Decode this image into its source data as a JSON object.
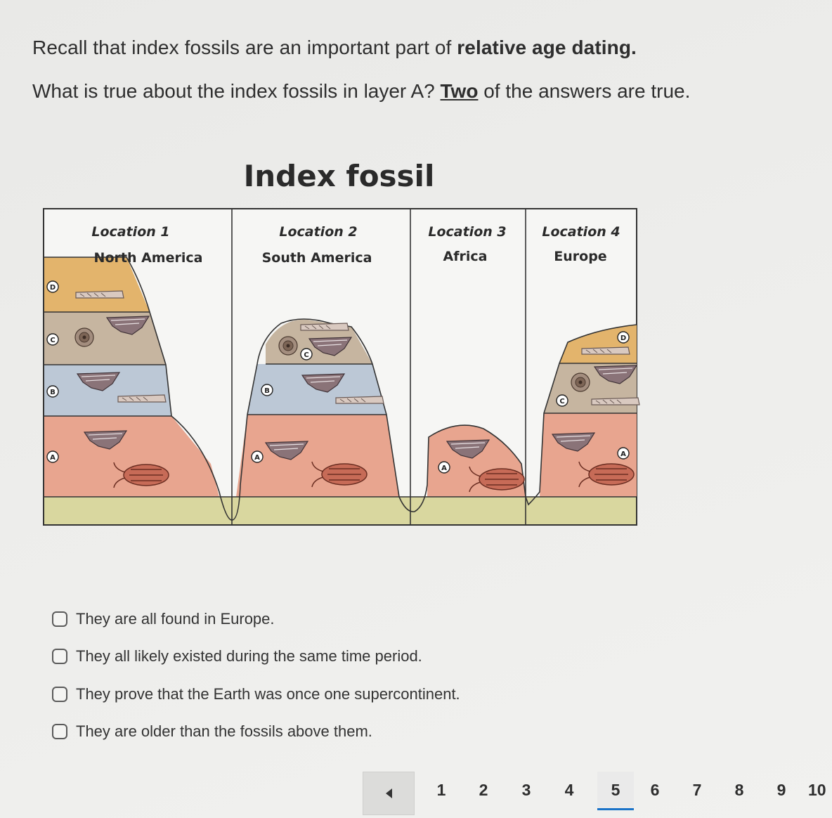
{
  "question": {
    "line1_prefix": "Recall that index fossils are an important part of ",
    "line1_bold": "relative age dating.",
    "line2_prefix": "What is true about the index fossils in layer A? ",
    "line2_emph": "Two",
    "line2_suffix": " of the answers are true."
  },
  "figure": {
    "title": "Index fossil",
    "locations": [
      {
        "label": "Location 1",
        "region": "North America"
      },
      {
        "label": "Location 2",
        "region": "South America"
      },
      {
        "label": "Location 3",
        "region": "Africa"
      },
      {
        "label": "Location 4",
        "region": "Europe"
      }
    ],
    "layer_labels": [
      "A",
      "B",
      "C",
      "D"
    ],
    "layer_colors": {
      "D": "#e3b46c",
      "C": "#c6b5a0",
      "B": "#bcc8d6",
      "A": "#e8a58f",
      "base": "#d9d79f"
    }
  },
  "options": [
    "They are all found in Europe.",
    "They all likely existed during the same time period.",
    "They prove that the Earth was once one supercontinent.",
    "They are older than the fossils above them."
  ],
  "pagination": {
    "pages": [
      "1",
      "2",
      "3",
      "4",
      "5",
      "6",
      "7",
      "8",
      "9",
      "10"
    ],
    "current": "5"
  }
}
